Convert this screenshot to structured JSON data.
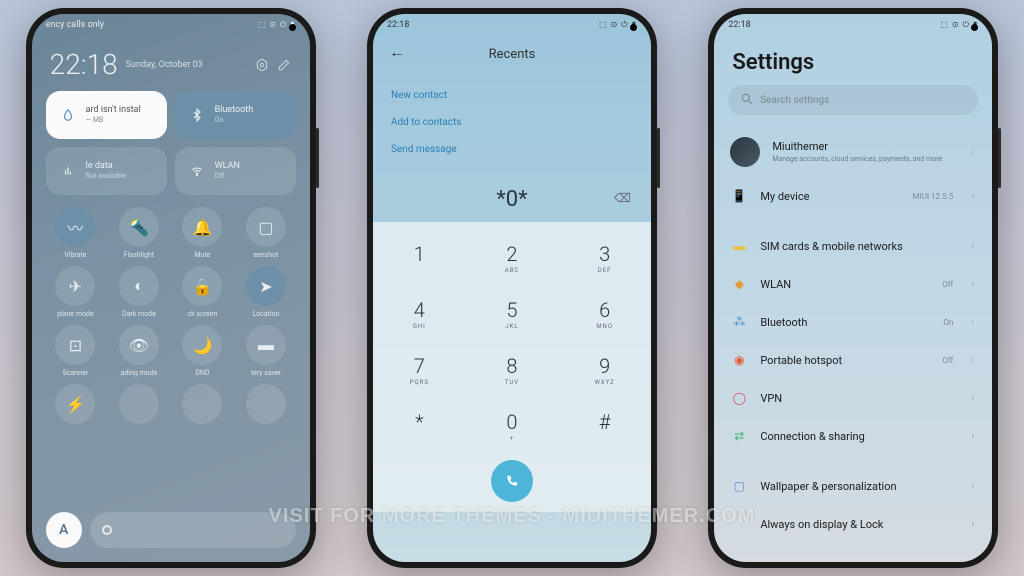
{
  "status_time": "22:18",
  "status_icons": "⬚ ⊙ ⏻ ▮",
  "watermark": "VISIT FOR MORE THEMES - MIUITHEMER.COM",
  "p1": {
    "emergency": "ency calls only",
    "time": "22:18",
    "date": "Sunday, October 03",
    "tiles": [
      {
        "title": "ard isn't instal",
        "sub": "— MB"
      },
      {
        "title": "Bluetooth",
        "sub": "On"
      },
      {
        "title": "le data",
        "sub": "Not available"
      },
      {
        "title": "WLAN",
        "sub": "Off"
      }
    ],
    "quick": [
      "Vibrate",
      "Flashlight",
      "Mute",
      "eenshot",
      "plane mode",
      "Dark mode",
      "ck screen",
      "Location",
      "Scanner",
      "ading mode",
      "DND",
      "tery saver",
      "",
      "",
      "",
      ""
    ],
    "auto": "A"
  },
  "p2": {
    "title": "Recents",
    "links": [
      "New contact",
      "Add to contacts",
      "Send message"
    ],
    "number": "*0*",
    "keys": [
      {
        "n": "1",
        "l": ""
      },
      {
        "n": "2",
        "l": "ABC"
      },
      {
        "n": "3",
        "l": "DEF"
      },
      {
        "n": "4",
        "l": "GHI"
      },
      {
        "n": "5",
        "l": "JKL"
      },
      {
        "n": "6",
        "l": "MNO"
      },
      {
        "n": "7",
        "l": "PQRS"
      },
      {
        "n": "8",
        "l": "TUV"
      },
      {
        "n": "9",
        "l": "WXYZ"
      },
      {
        "n": "*",
        "l": ""
      },
      {
        "n": "0",
        "l": "+"
      },
      {
        "n": "#",
        "l": ""
      }
    ]
  },
  "p3": {
    "title": "Settings",
    "search": "Search settings",
    "account": {
      "name": "Miuithemer",
      "sub": "Manage accounts, cloud services, payments, and more"
    },
    "items": [
      {
        "ico": "📱",
        "c": "#3cb371",
        "label": "My device",
        "val": "MIUI 12.5.5"
      },
      {
        "gap": true
      },
      {
        "ico": "▬",
        "c": "#e8c23a",
        "label": "SIM cards & mobile networks",
        "val": ""
      },
      {
        "ico": "◆",
        "c": "#e89a3a",
        "label": "WLAN",
        "val": "Off"
      },
      {
        "ico": "⁂",
        "c": "#4a8fd8",
        "label": "Bluetooth",
        "val": "On"
      },
      {
        "ico": "◉",
        "c": "#e85a3a",
        "label": "Portable hotspot",
        "val": "Off"
      },
      {
        "ico": "◯",
        "c": "#d84a5a",
        "label": "VPN",
        "val": ""
      },
      {
        "ico": "⇄",
        "c": "#3cb878",
        "label": "Connection & sharing",
        "val": ""
      },
      {
        "gap": true
      },
      {
        "ico": "▢",
        "c": "#5a8fd8",
        "label": "Wallpaper & personalization",
        "val": ""
      },
      {
        "ico": "",
        "c": "",
        "label": "Always on display & Lock",
        "val": ""
      }
    ]
  }
}
